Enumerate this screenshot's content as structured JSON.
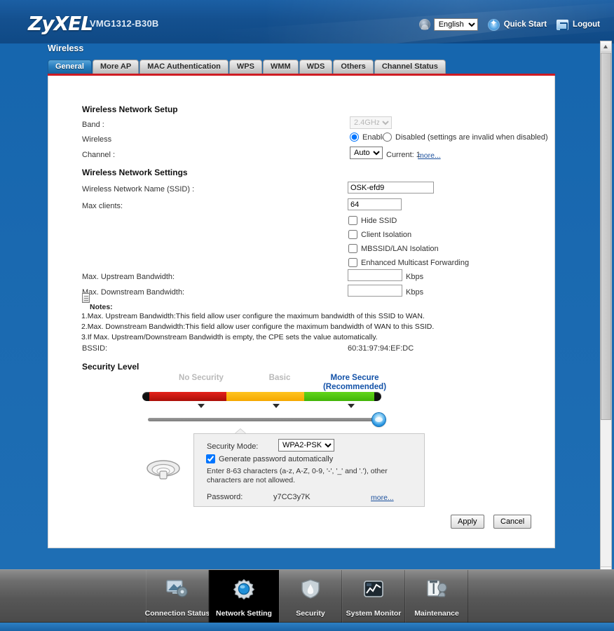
{
  "header": {
    "logo": "ZyXEL",
    "model": "VMG1312-B30B",
    "language": "English",
    "language_options": [
      "English"
    ],
    "quick_start": "Quick Start",
    "logout": "Logout",
    "icons": {
      "user": "user-icon",
      "star": "quick-start-icon",
      "logout": "logout-icon"
    }
  },
  "section": {
    "title": "Wireless",
    "tabs": [
      {
        "label": "General",
        "active": true
      },
      {
        "label": "More AP",
        "active": false
      },
      {
        "label": "MAC Authentication",
        "active": false
      },
      {
        "label": "WPS",
        "active": false
      },
      {
        "label": "WMM",
        "active": false
      },
      {
        "label": "WDS",
        "active": false
      },
      {
        "label": "Others",
        "active": false
      },
      {
        "label": "Channel Status",
        "active": false
      }
    ]
  },
  "setup": {
    "heading": "Wireless Network Setup",
    "band_label": "Band :",
    "band_value": "2.4GHz",
    "band_options": [
      "2.4GHz"
    ],
    "band_disabled": true,
    "wireless_label": "Wireless",
    "enable_label": "Enable",
    "disabled_label": "Disabled (settings are invalid when disabled)",
    "wireless_state": "Enable",
    "channel_label": "Channel :",
    "channel_value": "Auto",
    "channel_options": [
      "Auto"
    ],
    "channel_current": "Current: 1",
    "channel_more": "more..."
  },
  "settings": {
    "heading": "Wireless Network Settings",
    "ssid_label": "Wireless Network Name (SSID) :",
    "ssid_value": "OSK-efd9",
    "maxclients_label": "Max clients:",
    "maxclients_value": "64",
    "checkboxes": [
      {
        "label": "Hide SSID",
        "checked": false
      },
      {
        "label": "Client Isolation",
        "checked": false
      },
      {
        "label": "MBSSID/LAN Isolation",
        "checked": false
      },
      {
        "label": "Enhanced Multicast Forwarding",
        "checked": false
      }
    ],
    "upstream_label": "Max. Upstream Bandwidth:",
    "upstream_value": "",
    "downstream_label": "Max. Downstream Bandwidth:",
    "downstream_value": "",
    "kbps_unit": "Kbps",
    "notes_title": "Notes:",
    "notes": [
      "1.Max. Upstream Bandwidth:This field allow user configure the maximum bandwidth of this SSID to WAN.",
      "2.Max. Downstream Bandwidth:This field allow user configure the maximum bandwidth of WAN to this SSID.",
      "3.If Max. Upstream/Downstream Bandwidth is empty, the CPE sets the value automatically."
    ],
    "bssid_label": "BSSID:",
    "bssid_value": "60:31:97:94:EF:DC"
  },
  "security_level": {
    "heading": "Security Level",
    "steps": [
      {
        "label": "No Security",
        "active": false
      },
      {
        "label": "Basic",
        "active": false
      },
      {
        "label": "More Secure\n(Recommended)",
        "active": true
      }
    ],
    "step3_line1": "More Secure",
    "step3_line2": "(Recommended)",
    "selected": "More Secure (Recommended)",
    "colors": {
      "low": "#e5221a",
      "medium": "#ffc420",
      "high": "#63d51b",
      "accent": "#1352a8"
    }
  },
  "security_mode": {
    "mode_label": "Security Mode:",
    "mode_value": "WPA2-PSK",
    "mode_options": [
      "WPA2-PSK"
    ],
    "generate_label": "Generate password automatically",
    "generate_checked": true,
    "hint": "Enter 8-63 characters (a-z, A-Z, 0-9, '-', '_' and '.'), other characters are not allowed.",
    "password_label": "Password:",
    "password_value": "y7CC3y7K",
    "more_link": "more..."
  },
  "actions": {
    "apply": "Apply",
    "cancel": "Cancel"
  },
  "bottom_nav": [
    {
      "label": "Connection Status",
      "icon": "monitor-icon",
      "active": false
    },
    {
      "label": "Network Setting",
      "icon": "gear-icon",
      "active": true
    },
    {
      "label": "Security",
      "icon": "shield-icon",
      "active": false
    },
    {
      "label": "System Monitor",
      "icon": "chart-icon",
      "active": false
    },
    {
      "label": "Maintenance",
      "icon": "tools-icon",
      "active": false
    }
  ]
}
